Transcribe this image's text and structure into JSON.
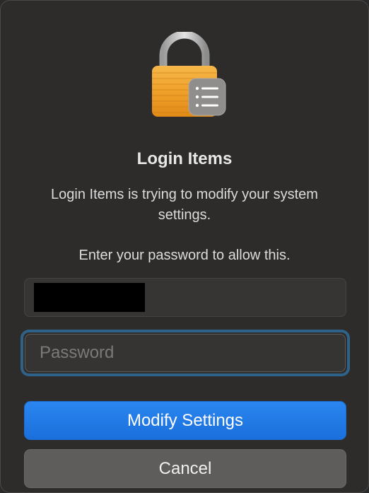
{
  "dialog": {
    "title": "Login Items",
    "message": "Login Items is trying to modify your system settings.",
    "prompt": "Enter your password to allow this.",
    "username": {
      "redacted": true
    },
    "password": {
      "placeholder": "Password",
      "value": ""
    },
    "primary_button": "Modify Settings",
    "secondary_button": "Cancel",
    "icon": "lock-with-list-badge-icon"
  },
  "colors": {
    "background": "#2d2c2b",
    "accent": "#1a78f0",
    "focus_ring": "#2f6288",
    "lock_gold": "#f0a12a"
  }
}
